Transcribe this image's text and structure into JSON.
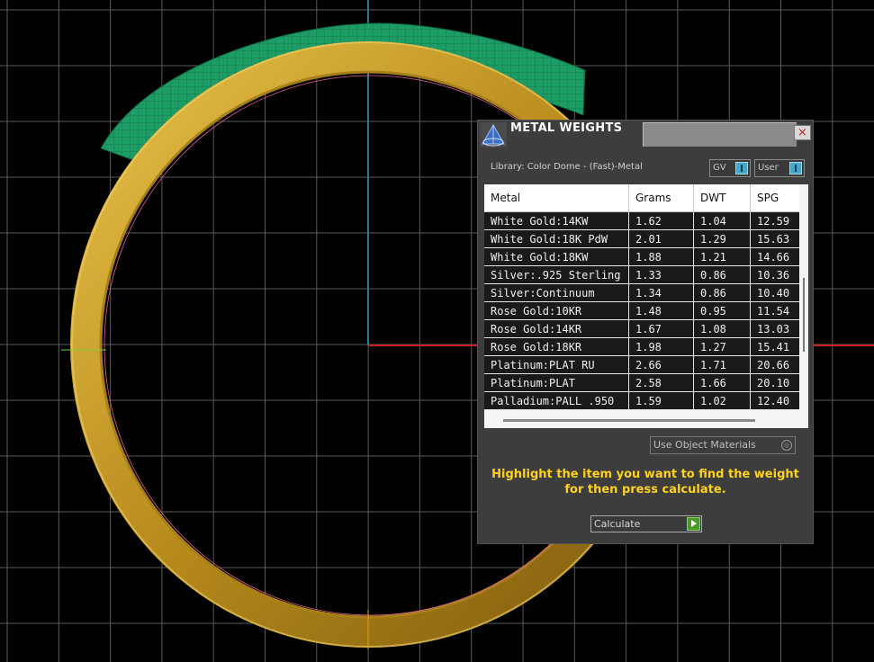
{
  "panel": {
    "title": "METAL WEIGHTS",
    "close_glyph": "×",
    "library_label": "Library: Color Dome - (Fast)-Metal",
    "gv_label": "GV",
    "user_label": "User",
    "use_object_materials_label": "Use Object Materials",
    "hint_line1": "Highlight the item you want to find the weight",
    "hint_line2": "for then press calculate.",
    "calculate_label": "Calculate",
    "icons": {
      "logo": "pyramid-logo-icon",
      "close": "close-icon",
      "calculate": "play-icon"
    }
  },
  "table": {
    "columns": [
      "Metal",
      "Grams",
      "DWT",
      "SPG"
    ],
    "rows": [
      [
        "White Gold:14KW",
        "1.62",
        "1.04",
        "12.59"
      ],
      [
        "White Gold:18K PdW",
        "2.01",
        "1.29",
        "15.63"
      ],
      [
        "White Gold:18KW",
        "1.88",
        "1.21",
        "14.66"
      ],
      [
        "Silver:.925 Sterling",
        "1.33",
        "0.86",
        "10.36"
      ],
      [
        "Silver:Continuum",
        "1.34",
        "0.86",
        "10.40"
      ],
      [
        "Rose Gold:10KR",
        "1.48",
        "0.95",
        "11.54"
      ],
      [
        "Rose Gold:14KR",
        "1.67",
        "1.08",
        "13.03"
      ],
      [
        "Rose Gold:18KR",
        "1.98",
        "1.27",
        "15.41"
      ],
      [
        "Platinum:PLAT RU",
        "2.66",
        "1.71",
        "20.66"
      ],
      [
        "Platinum:PLAT",
        "2.58",
        "1.66",
        "20.10"
      ],
      [
        "Palladium:PALL .950",
        "1.59",
        "1.02",
        "12.40"
      ]
    ]
  },
  "colors": {
    "ring_gold": "#c9a02c",
    "ring_green": "#1f9a66",
    "grid": "#5a5a5a",
    "axis_x": "#c62020",
    "axis_y": "#2b7d90",
    "hint_text": "#ffd21f",
    "panel_bg": "#3d3d3d"
  }
}
